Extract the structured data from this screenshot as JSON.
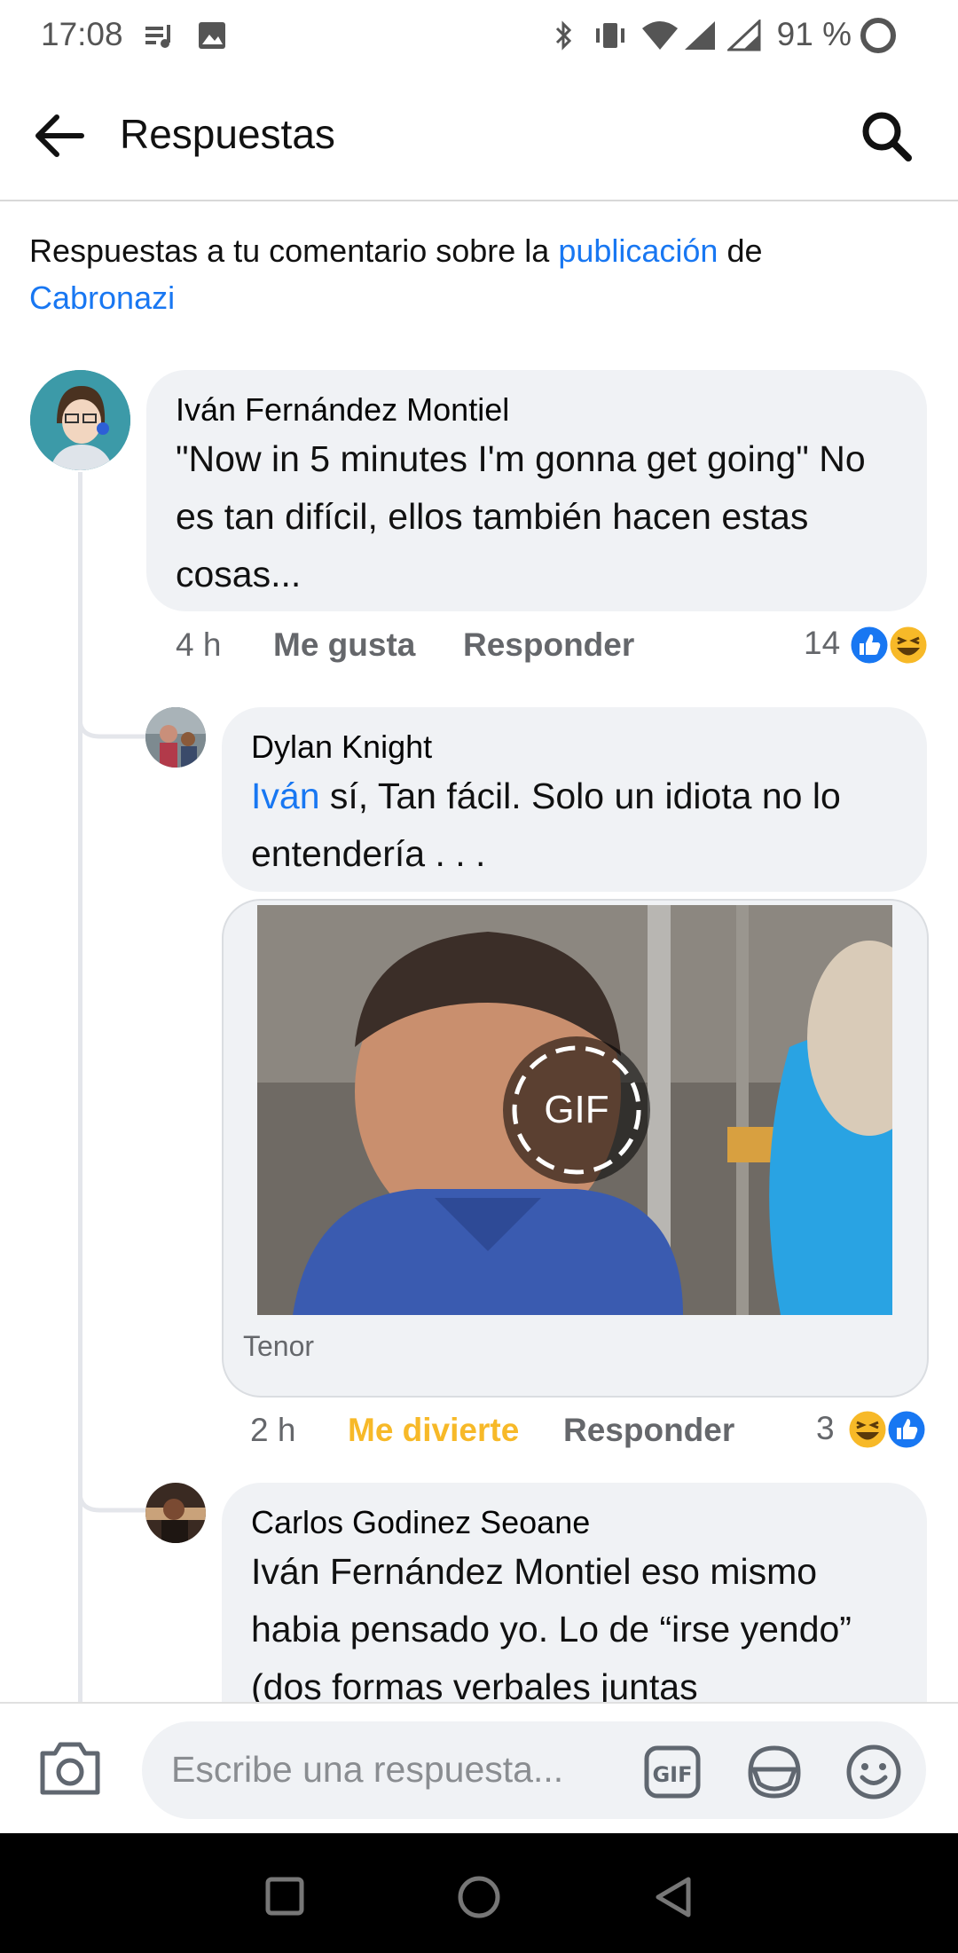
{
  "status_bar": {
    "time": "17:08",
    "battery": "91 %"
  },
  "header": {
    "title": "Respuestas"
  },
  "context": {
    "prefix": "Respuestas a tu comentario sobre la ",
    "link1": "publicación",
    "middle": " de",
    "link2": "Cabronazi"
  },
  "comments": [
    {
      "author": "Iván Fernández Montiel",
      "text": "\"Now in 5 minutes I'm gonna get going\" No es tan difícil, ellos también hacen estas cosas...",
      "time": "4 h",
      "like": "Me gusta",
      "reply": "Responder",
      "reaction_count": "14",
      "reactions": [
        "like-reaction-icon",
        "haha-reaction-icon"
      ]
    },
    {
      "author": "Dylan Knight",
      "mention": "Iván",
      "text": " sí, Tan fácil. Solo un idiota no lo entendería . . .",
      "gif_label": "GIF",
      "gif_source": "Tenor",
      "time": "2 h",
      "like": "Me divierte",
      "reply": "Responder",
      "reaction_count": "3",
      "reactions": [
        "haha-reaction-icon",
        "like-reaction-icon"
      ]
    },
    {
      "author": "Carlos Godinez Seoane",
      "text": "Iván Fernández Montiel eso mismo habia pensado yo. Lo de “irse yendo” (dos formas verbales juntas"
    }
  ],
  "composer": {
    "placeholder": "Escribe una respuesta..."
  },
  "colors": {
    "link": "#1877f2",
    "haha": "#f7b928",
    "bubble": "#f0f2f5"
  }
}
